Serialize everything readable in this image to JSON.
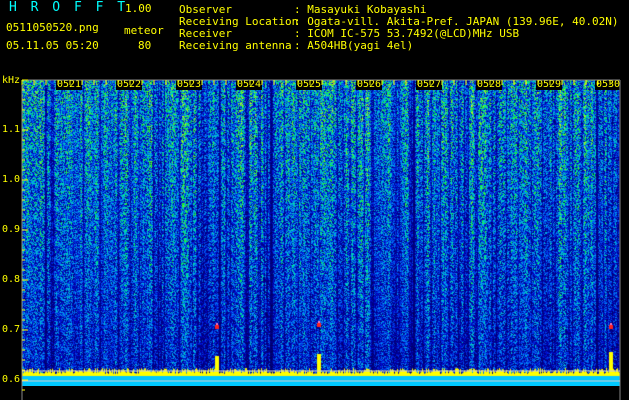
{
  "app": {
    "title": "H R O F F T",
    "version": "1.00",
    "filename": "0511050520.png",
    "datetime": "05.11.05 05:20",
    "counter_label": "meteor",
    "counter_value": "80"
  },
  "info": {
    "rows": [
      {
        "label": "Observer",
        "value": ": Masayuki Kobayashi"
      },
      {
        "label": "Receiving Location",
        "value": ": Ogata-vill. Akita-Pref. JAPAN (139.96E, 40.02N)"
      },
      {
        "label": "Receiver",
        "value": ": ICOM IC-575 53.7492(@LCD)MHz USB"
      },
      {
        "label": "Receiving antenna",
        "value": ": A504HB(yagi 4el)"
      }
    ]
  },
  "axis": {
    "unit": "kHz",
    "freq_ticks": [
      "1.1",
      "1.0",
      "0.9",
      "0.8",
      "0.7",
      "0.6"
    ],
    "time_ticks": [
      "0521",
      "0522",
      "0523",
      "0524",
      "0525",
      "0526",
      "0527",
      "0528",
      "0529",
      "0530"
    ]
  },
  "colors": {
    "header_text": "#ffff00",
    "accent_text": "#00ffff",
    "background": "#000000",
    "spectrum_low": "#000080",
    "spectrum_high": "#ffff00"
  }
}
